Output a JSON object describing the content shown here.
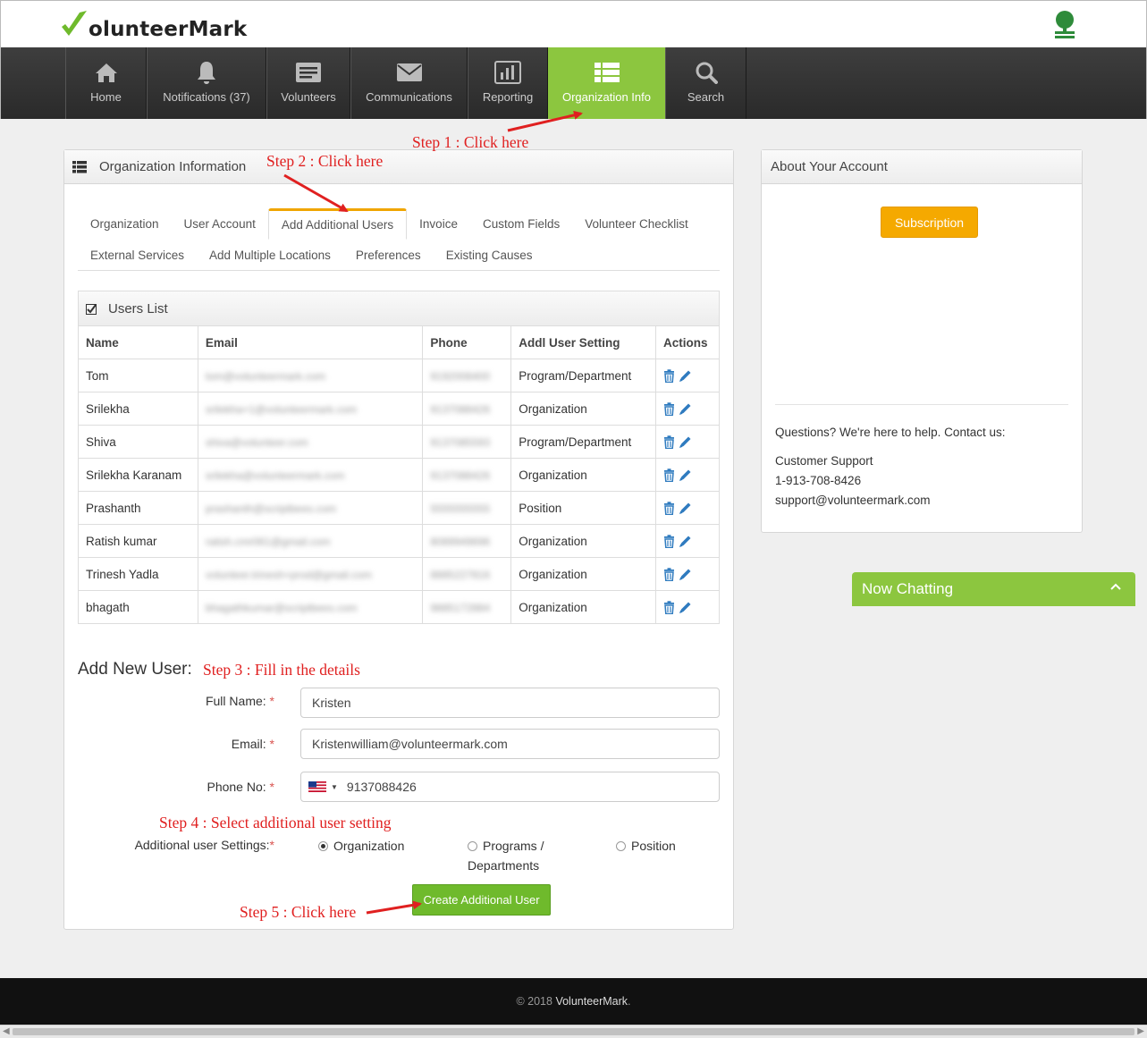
{
  "header": {
    "logo_text": "olunteerMark"
  },
  "nav": [
    {
      "label": "Home",
      "icon": "home-icon"
    },
    {
      "label": "Notifications  (37)",
      "icon": "bell-icon"
    },
    {
      "label": "Volunteers",
      "icon": "id-card-icon"
    },
    {
      "label": "Communications",
      "icon": "envelope-icon"
    },
    {
      "label": "Reporting",
      "icon": "bar-chart-icon"
    },
    {
      "label": "Organization Info",
      "icon": "list-icon",
      "active": true
    },
    {
      "label": "Search",
      "icon": "search-icon"
    }
  ],
  "org_panel": {
    "title": "Organization Information",
    "tabs_row1": [
      "Organization",
      "User Account",
      "Add Additional Users",
      "Invoice",
      "Custom Fields",
      "Volunteer Checklist"
    ],
    "tabs_row2": [
      "External Services",
      "Add Multiple Locations",
      "Preferences",
      "Existing Causes"
    ],
    "active_tab": "Add Additional Users",
    "users_list_title": "Users List",
    "columns": [
      "Name",
      "Email",
      "Phone",
      "Addl User Setting",
      "Actions"
    ],
    "rows": [
      {
        "name": "Tom",
        "email": "tom@volunteermark.com",
        "phone": "9192008400",
        "setting": "Program/Department"
      },
      {
        "name": "Srilekha",
        "email": "srilekha+1@volunteermark.com",
        "phone": "9137088426",
        "setting": "Organization"
      },
      {
        "name": "Shiva",
        "email": "shiva@volunteer.com",
        "phone": "9137085593",
        "setting": "Program/Department"
      },
      {
        "name": "Srilekha Karanam",
        "email": "srilekha@volunteermark.com",
        "phone": "9137088426",
        "setting": "Organization"
      },
      {
        "name": "Prashanth",
        "email": "prashanth@scriptbees.com",
        "phone": "5555555555",
        "setting": "Position"
      },
      {
        "name": "Ratish kumar",
        "email": "ratish.cmr061@gmail.com",
        "phone": "8089949696",
        "setting": "Organization"
      },
      {
        "name": "Trinesh Yadla",
        "email": "volunteer.trinesh+prod@gmail.com",
        "phone": "8885227816",
        "setting": "Organization"
      },
      {
        "name": "bhagath",
        "email": "bhagathkumar@scriptbees.com",
        "phone": "9885172884",
        "setting": "Organization"
      }
    ],
    "form": {
      "heading": "Add New User:",
      "full_name_label": "Full Name:",
      "full_name_value": "Kristen",
      "email_label": "Email:",
      "email_value": "Kristenwilliam@volunteermark.com",
      "phone_label": "Phone No:",
      "phone_value": "9137088426",
      "required_mark": "*",
      "settings_label": "Additional user Settings:",
      "settings_options": [
        "Organization",
        "Programs /",
        "Departments",
        "Position"
      ],
      "selected_setting": "Organization",
      "submit_label": "Create Additional User"
    }
  },
  "account_panel": {
    "title": "About Your Account",
    "subscription_label": "Subscription",
    "help_text": "Questions? We're here to help. Contact us:",
    "support_label": "Customer Support",
    "support_phone": "1-913-708-8426",
    "support_email": "support@volunteermark.com"
  },
  "chat": {
    "label": "Now Chatting"
  },
  "annotations": {
    "step1": "Step 1 : Click here",
    "step2": "Step 2 : Click here",
    "step3": "Step 3 : Fill in the details",
    "step4": "Step 4 : Select additional user setting",
    "step5": "Step 5 : Click here"
  },
  "footer": {
    "copyright": "© 2018 ",
    "brand": "VolunteerMark",
    "suffix": "."
  },
  "colors": {
    "brand_green": "#8cc63f",
    "button_green": "#6fba2c",
    "accent_orange": "#f5a900",
    "annotation_red": "#e02020",
    "nav_dark": "#333333"
  }
}
